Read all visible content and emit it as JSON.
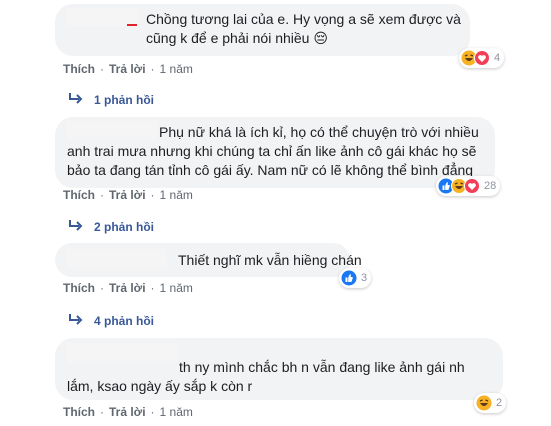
{
  "comments": [
    {
      "text": "Chồng tương lai của e. Hy vọng a sẽ xem được và\ncũng k để e phải nói nhiều 😔",
      "actions": {
        "like": "Thích",
        "reply": "Trả lời",
        "age": "1 năm"
      },
      "reaction_count": "4",
      "reaction_icons": [
        "haha-icon",
        "love-icon"
      ],
      "replies": "1 phản hồi"
    },
    {
      "text": "Phụ nữ khá là ích kỉ, họ có thể chuyện trò với nhiều\nanh trai mưa nhưng khi chúng ta chỉ ấn like ảnh cô gái khác họ sẽ\nbảo ta đang tán tỉnh cô gái ấy. Nam nữ có lẽ không thể bình đẳng",
      "actions": {
        "like": "Thích",
        "reply": "Trả lời",
        "age": "1 năm"
      },
      "reaction_count": "28",
      "reaction_icons": [
        "like-icon",
        "haha-icon",
        "love-icon"
      ],
      "replies": "2 phản hồi"
    },
    {
      "text": "Thiết nghĩ mk vẫn hiềng chán",
      "actions": {
        "like": "Thích",
        "reply": "Trả lời",
        "age": "1 năm"
      },
      "reaction_count": "3",
      "reaction_icons": [
        "like-icon"
      ],
      "replies": "4 phản hồi"
    },
    {
      "text": "th ny mình chắc bh n vẫn đang like ảnh gái nh\nlắm, ksao ngày ấy sắp k còn r",
      "actions": {
        "like": "Thích",
        "reply": "Trả lời",
        "age": "1 năm"
      },
      "reaction_count": "2",
      "reaction_icons": [
        "haha-icon"
      ]
    }
  ],
  "colors": {
    "bubble": "#f2f3f5",
    "link_blue": "#385898",
    "meta_gray": "#606770",
    "like_blue": "#1877f2",
    "love_red": "#f33e58",
    "haha_yellow": "#f7b125"
  }
}
